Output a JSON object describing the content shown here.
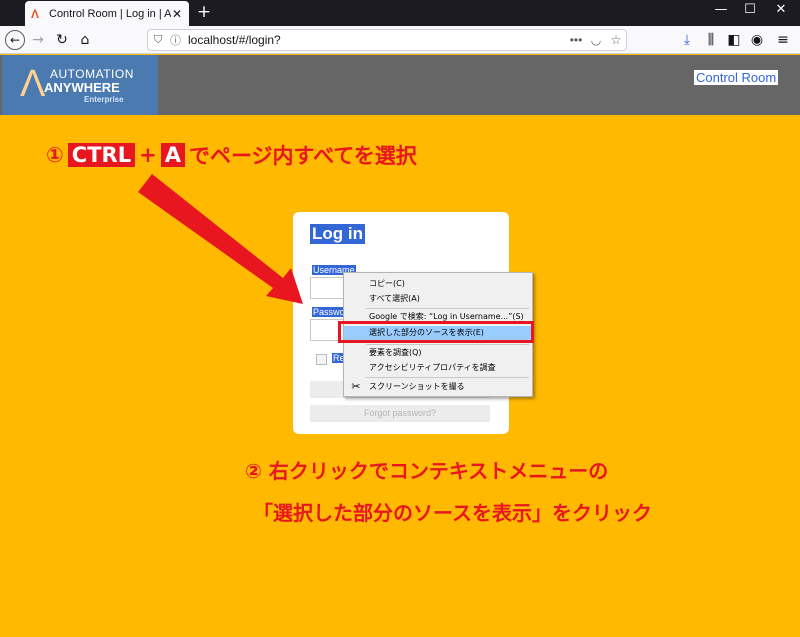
{
  "browser": {
    "tab_title": "Control Room | Log in | Autom",
    "tab_close": "✕",
    "new_tab": "+",
    "url": "localhost/#/login?",
    "url_menu": "•••"
  },
  "app": {
    "logo_line1": "AUTOMATION",
    "logo_line2": "ANYWHERE",
    "logo_line3": "Enterprise",
    "header_link": "Control Room"
  },
  "login": {
    "title": "Log in",
    "username_label": "Username",
    "password_label": "Passwo",
    "remember_label": "Re",
    "forgot_label": "Forgot password?"
  },
  "context_menu": {
    "items": [
      "コピー(C)",
      "すべて選択(A)",
      "Google で検索: “Log in Username...”(S)",
      "選択した部分のソースを表示(E)",
      "要素を調査(Q)",
      "アクセシビリティプロパティを調査",
      "スクリーンショットを撮る"
    ],
    "highlighted_index": 3
  },
  "annotations": {
    "step1_prefix": "①",
    "step1_key1": "CTRL",
    "step1_plus": "+",
    "step1_key2": "A",
    "step1_suffix": "でページ内すべてを選択",
    "step2": "② 右クリックでコンテキストメニューの",
    "step3": "「選択した部分のソースを表示」をクリック"
  },
  "colors": {
    "background": "#ffb900",
    "annotation_red": "#e8171f",
    "selection_blue": "#3367d6",
    "menu_highlight": "#99ccff"
  }
}
